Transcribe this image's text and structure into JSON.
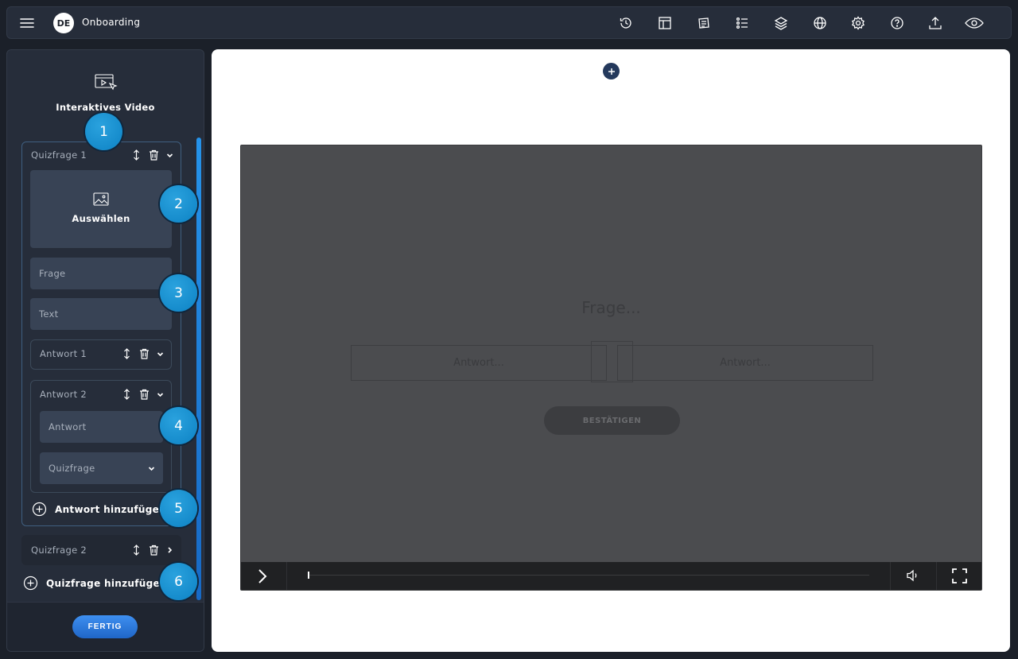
{
  "topbar": {
    "language_badge": "DE",
    "title": "Onboarding",
    "tool_icons": [
      "history-icon",
      "layout-icon",
      "stamp-icon",
      "checklist-icon",
      "layers-icon",
      "globe-icon",
      "gear-icon",
      "help-icon",
      "upload-icon",
      "preview-eye-icon"
    ]
  },
  "sidebar": {
    "heading": "Interaktives Video",
    "quiz1": {
      "label": "Quizfrage 1",
      "image_select_label": "Auswählen",
      "question_placeholder": "Frage",
      "text_placeholder": "Text",
      "answer1_label": "Antwort 1",
      "answer2_label": "Antwort 2",
      "answer_placeholder": "Antwort",
      "target_select_value": "Quizfrage",
      "add_answer_label": "Antwort hinzufügen"
    },
    "quiz2": {
      "label": "Quizfrage 2"
    },
    "add_quiz_label": "Quizfrage hinzufügen",
    "done_label": "FERTIG"
  },
  "badges": [
    "1",
    "2",
    "3",
    "4",
    "5",
    "6"
  ],
  "preview": {
    "question": "Frage...",
    "answer_left": "Antwort...",
    "answer_right": "Antwort...",
    "confirm_label": "BESTÄTIGEN",
    "progress": 0
  },
  "colors": {
    "accent_blue": "#1f8fdc",
    "panel_bg": "#262d3a",
    "video_bg": "#4b4c4f"
  }
}
